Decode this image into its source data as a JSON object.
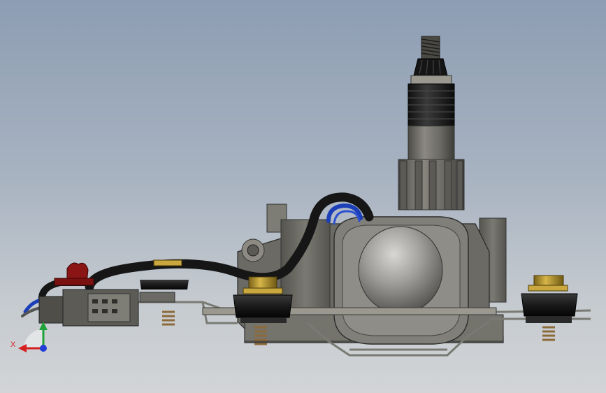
{
  "viewport": {
    "background_top": "#8d9db3",
    "background_bottom": "#d2d4d6"
  },
  "triad": {
    "x_label": "X",
    "x_color": "#d42020",
    "y_color": "#1fa33a",
    "z_color": "#1f3fd6"
  },
  "model": {
    "parts": [
      "output-shaft",
      "shaft-housing",
      "gearbox-housing",
      "motor-dome",
      "mounting-bracket",
      "rubber-grommet-left",
      "rubber-grommet-right",
      "wire-harness",
      "electrical-connector",
      "harness-clip"
    ],
    "colors": {
      "housing": "#6b6a64",
      "metal_light": "#9a988f",
      "dome": "#a2a19d",
      "cable": "#1b1b1b",
      "blue_wire": "#1c3fb8",
      "brass": "#b8972f",
      "clip_red": "#8b1414",
      "rubber": "#1e1e1e",
      "spring": "#8c6a3a"
    }
  }
}
